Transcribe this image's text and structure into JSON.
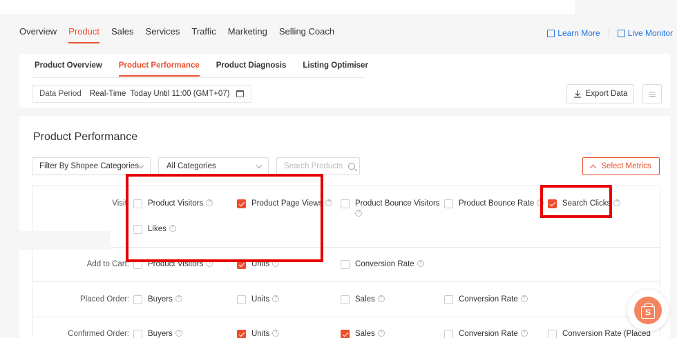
{
  "topnav": {
    "tabs": [
      "Overview",
      "Product",
      "Sales",
      "Services",
      "Traffic",
      "Marketing",
      "Selling Coach"
    ],
    "active": "Product",
    "learn_more": "Learn More",
    "live_monitor": "Live Monitor"
  },
  "subnav": {
    "tabs": [
      "Product Overview",
      "Product Performance",
      "Product Diagnosis",
      "Listing Optimiser"
    ],
    "active": "Product Performance"
  },
  "period": {
    "label": "Data Period",
    "value": "Real-Time  Today Until 11:00 (GMT+07)"
  },
  "export_label": "Export Data",
  "section_title": "Product Performance",
  "filters": {
    "category_filter": "Filter By Shopee Categories",
    "category_select": "All Categories",
    "search_placeholder": "Search Products",
    "select_metrics": "Select Metrics"
  },
  "metrics": {
    "visit": {
      "label": "Visit:",
      "items": [
        {
          "label": "Product Visitors",
          "checked": false
        },
        {
          "label": "Product Page Views",
          "checked": true
        },
        {
          "label": "Product Bounce Visitors",
          "checked": false
        },
        {
          "label": "Product Bounce Rate",
          "checked": false
        },
        {
          "label": "Search Clicks",
          "checked": true
        },
        {
          "label": "Likes",
          "checked": false
        }
      ]
    },
    "add_to_cart": {
      "label": "Add to Cart:",
      "items": [
        {
          "label": "Product Visitors",
          "checked": false
        },
        {
          "label": "Units",
          "checked": true
        },
        {
          "label": "Conversion Rate",
          "checked": false
        }
      ]
    },
    "placed_order": {
      "label": "Placed Order:",
      "items": [
        {
          "label": "Buyers",
          "checked": false
        },
        {
          "label": "Units",
          "checked": false
        },
        {
          "label": "Sales",
          "checked": false
        },
        {
          "label": "Conversion Rate",
          "checked": false
        }
      ]
    },
    "confirmed_order": {
      "label": "Confirmed Order:",
      "items": [
        {
          "label": "Buyers",
          "checked": false
        },
        {
          "label": "Units",
          "checked": true
        },
        {
          "label": "Sales",
          "checked": true
        },
        {
          "label": "Conversion Rate",
          "checked": false
        },
        {
          "label": "Conversion Rate (Placed",
          "checked": false
        }
      ]
    }
  },
  "colors": {
    "accent": "#ee4d2d",
    "link": "#2673dd",
    "highlight": "#e60000"
  },
  "icons": [
    "learn-more-icon",
    "monitor-icon",
    "calendar-icon",
    "download-icon",
    "menu-icon",
    "search-icon",
    "chevron-up-icon",
    "help-icon",
    "shopee-bag-icon"
  ],
  "fab_letter": "S"
}
